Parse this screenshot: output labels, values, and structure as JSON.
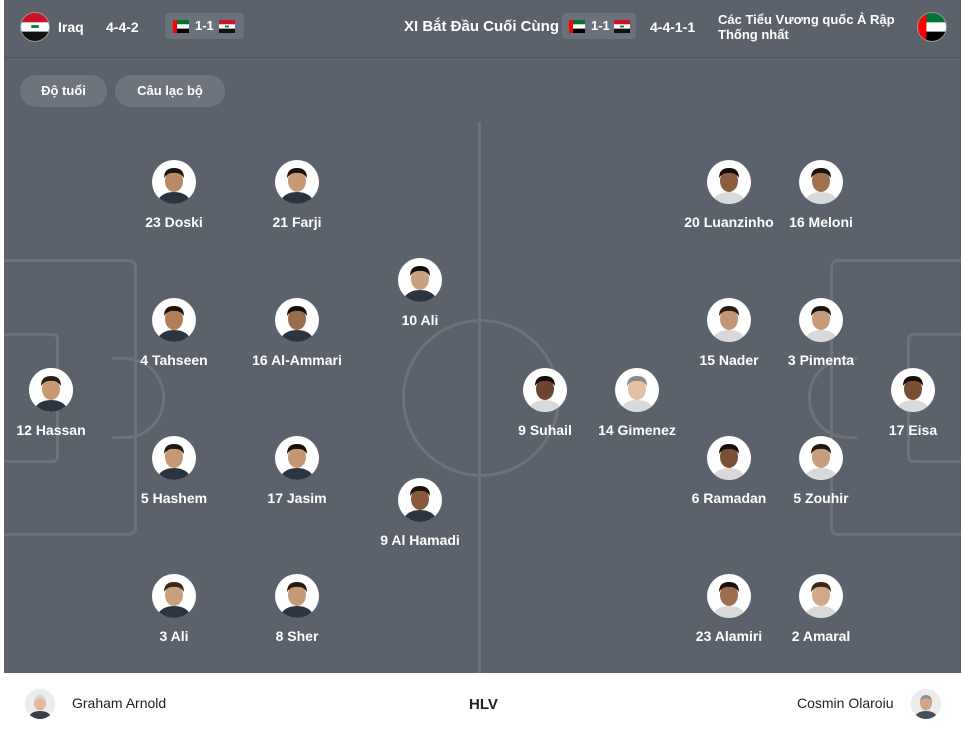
{
  "header": {
    "home_team": "Iraq",
    "home_formation": "4-4-2",
    "home_score_display": "1-1",
    "title": "XI Bắt Đầu Cuối Cùng",
    "away_score_display": "1-1",
    "away_formation": "4-4-1-1",
    "away_team_line1": "Các Tiểu Vương quốc Ả Rập",
    "away_team_line2": "Thống nhất"
  },
  "filters": {
    "age_label": "Độ tuổi",
    "club_label": "Câu lạc bộ"
  },
  "home_players": [
    {
      "label": "12 Hassan",
      "skin": "#c89a72",
      "hair": "#2b1d14"
    },
    {
      "label": "23 Doski",
      "skin": "#b98a66",
      "hair": "#1f1510"
    },
    {
      "label": "4 Tahseen",
      "skin": "#b17e5a",
      "hair": "#1c130d"
    },
    {
      "label": "5 Hashem",
      "skin": "#c69874",
      "hair": "#241812"
    },
    {
      "label": "3 Ali",
      "skin": "#c9a07c",
      "hair": "#3a2a1e"
    },
    {
      "label": "21 Farji",
      "skin": "#c79a75",
      "hair": "#1b120c"
    },
    {
      "label": "16 Al-Ammari",
      "skin": "#9a6b4b",
      "hair": "#140d09"
    },
    {
      "label": "17 Jasim",
      "skin": "#c49674",
      "hair": "#161009"
    },
    {
      "label": "8 Sher",
      "skin": "#c59a78",
      "hair": "#2a1c12"
    },
    {
      "label": "10 Ali",
      "skin": "#caa080",
      "hair": "#120c08"
    },
    {
      "label": "9 Al Hamadi",
      "skin": "#8a5a3c",
      "hair": "#1e140e"
    }
  ],
  "away_players": [
    {
      "label": "17 Eisa",
      "skin": "#7a4e34",
      "hair": "#140d09"
    },
    {
      "label": "16 Meloni",
      "skin": "#a0704f",
      "hair": "#1a120c"
    },
    {
      "label": "3 Pimenta",
      "skin": "#c69b7a",
      "hair": "#1b120c"
    },
    {
      "label": "5 Zouhir",
      "skin": "#c89d7b",
      "hair": "#221710"
    },
    {
      "label": "2 Amaral",
      "skin": "#d2a886",
      "hair": "#3b2a1c"
    },
    {
      "label": "20 Luanzinho",
      "skin": "#8c5d40",
      "hair": "#140d09"
    },
    {
      "label": "15 Nader",
      "skin": "#c29574",
      "hair": "#2a1c12"
    },
    {
      "label": "6 Ramadan",
      "skin": "#7c5036",
      "hair": "#140d09"
    },
    {
      "label": "23 Alamiri",
      "skin": "#9c6d4e",
      "hair": "#1a110b"
    },
    {
      "label": "14 Gimenez",
      "skin": "#e2c1a6",
      "hair": "#8a8a8a"
    },
    {
      "label": "9 Suhail",
      "skin": "#6e4430",
      "hair": "#120c08"
    }
  ],
  "footer": {
    "home_coach": "Graham Arnold",
    "label": "HLV",
    "away_coach": "Cosmin Olaroiu"
  },
  "colors": {
    "pitch": "#5b626c",
    "pitch_lines": "#6c737d",
    "pill": "#6d747d",
    "text": "#ffffff"
  },
  "icons": {
    "iraq_flag": "iraq-flag-icon",
    "uae_flag": "uae-flag-icon"
  }
}
